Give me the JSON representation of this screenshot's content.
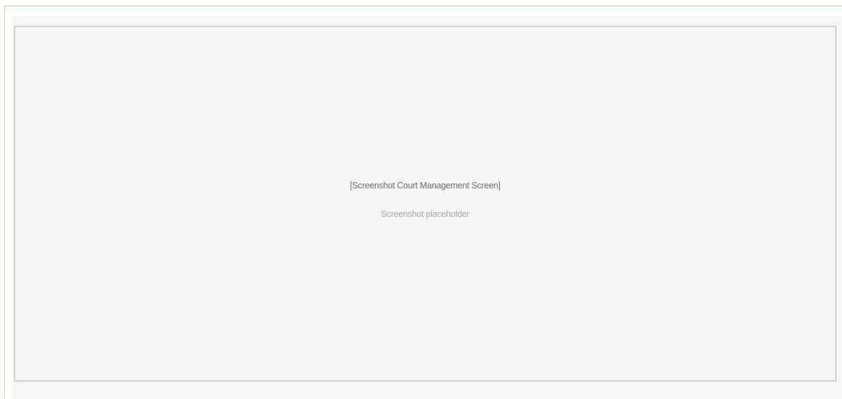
{
  "screenshot": {
    "title": "[Screenshot Court Management Screen]",
    "subtitle": "Screenshot placeholder"
  },
  "colors": {
    "frame_border": "#e9c7a4",
    "panel_background": "#f5f5f5",
    "box_border": "#d0d0d0",
    "title_text": "#6f6f6f",
    "subtitle_text": "#a8a8a8"
  }
}
